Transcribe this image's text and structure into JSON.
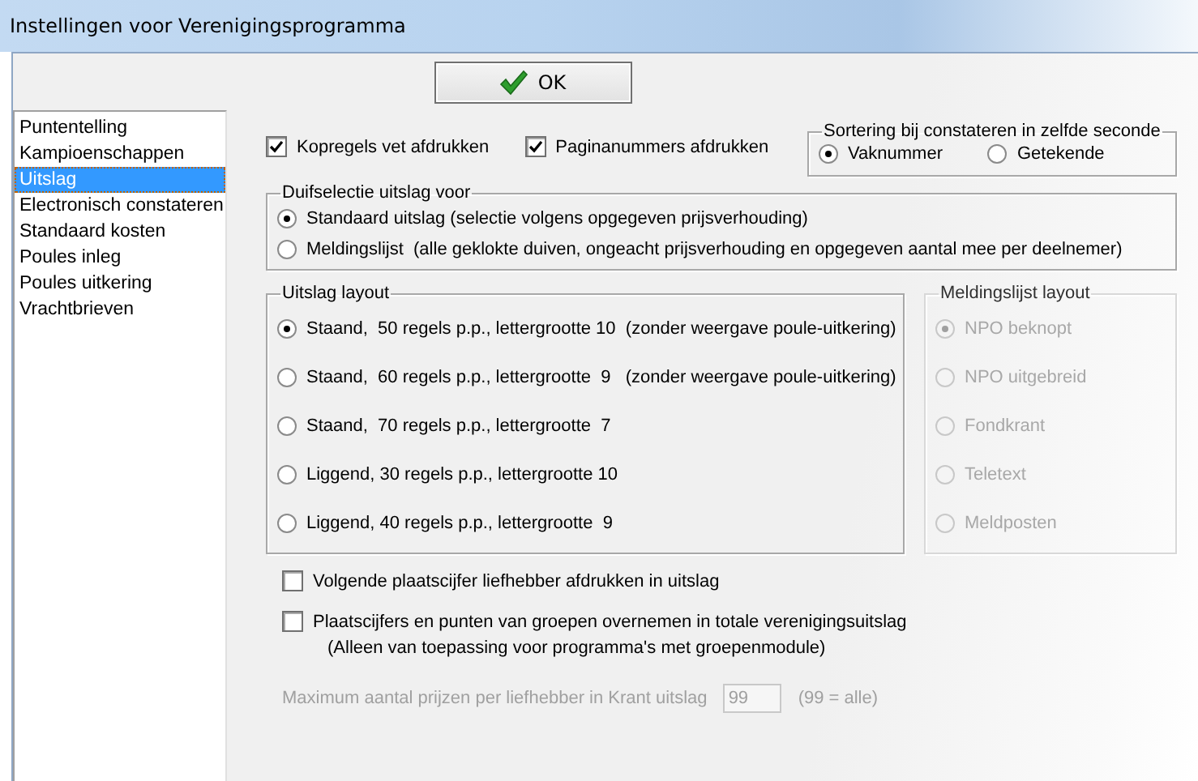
{
  "window": {
    "title": "Instellingen voor Verenigingsprogramma"
  },
  "ok_button": {
    "label": "OK"
  },
  "sidebar": {
    "items": [
      {
        "label": "Puntentelling",
        "selected": false
      },
      {
        "label": "Kampioenschappen",
        "selected": false
      },
      {
        "label": "Uitslag",
        "selected": true
      },
      {
        "label": "Electronisch constateren",
        "selected": false
      },
      {
        "label": "Standaard kosten",
        "selected": false
      },
      {
        "label": "Poules inleg",
        "selected": false
      },
      {
        "label": "Poules uitkering",
        "selected": false
      },
      {
        "label": "Vrachtbrieven",
        "selected": false
      }
    ]
  },
  "print_options": [
    {
      "label": "Kopregels vet afdrukken",
      "checked": true
    },
    {
      "label": "Paginanummers afdrukken",
      "checked": true
    }
  ],
  "sort_group": {
    "title": "Sortering bij constateren in zelfde seconde",
    "options": [
      {
        "label": "Vaknummer",
        "selected": true
      },
      {
        "label": "Getekende",
        "selected": false
      }
    ]
  },
  "pigeon_selection": {
    "title": "Duifselectie uitslag voor",
    "options": [
      {
        "label": "Standaard uitslag (selectie volgens opgegeven prijsverhouding)",
        "selected": true
      },
      {
        "label": "Meldingslijst  (alle geklokte duiven, ongeacht prijsverhouding en opgegeven aantal mee per deelnemer)",
        "selected": false
      }
    ]
  },
  "result_layout": {
    "title": "Uitslag layout",
    "options": [
      {
        "label": "Staand,  50 regels p.p., lettergrootte 10  (zonder weergave poule-uitkering)",
        "selected": true
      },
      {
        "label": "Staand,  60 regels p.p., lettergrootte  9   (zonder weergave poule-uitkering)",
        "selected": false
      },
      {
        "label": "Staand,  70 regels p.p., lettergrootte  7",
        "selected": false
      },
      {
        "label": "Liggend, 30 regels p.p., lettergrootte 10",
        "selected": false
      },
      {
        "label": "Liggend, 40 regels p.p., lettergrootte  9",
        "selected": false
      }
    ]
  },
  "report_layout": {
    "title": "Meldingslijst layout",
    "disabled": true,
    "options": [
      {
        "label": "NPO beknopt",
        "selected": true
      },
      {
        "label": "NPO uitgebreid",
        "selected": false
      },
      {
        "label": "Fondkrant",
        "selected": false
      },
      {
        "label": "Teletext",
        "selected": false
      },
      {
        "label": "Meldposten",
        "selected": false
      }
    ]
  },
  "extra_options": [
    {
      "label": "Volgende plaatscijfer liefhebber afdrukken in uitslag",
      "checked": false
    },
    {
      "label": "Plaatscijfers en punten van groepen overnemen in totale verenigingsuitslag",
      "checked": false,
      "note": "(Alleen van toepassing voor programma's met groepenmodule)"
    }
  ],
  "max_prizes": {
    "label": "Maximum aantal prijzen per liefhebber in Krant uitslag",
    "value": "99",
    "hint": "(99 = alle)",
    "disabled": true
  }
}
